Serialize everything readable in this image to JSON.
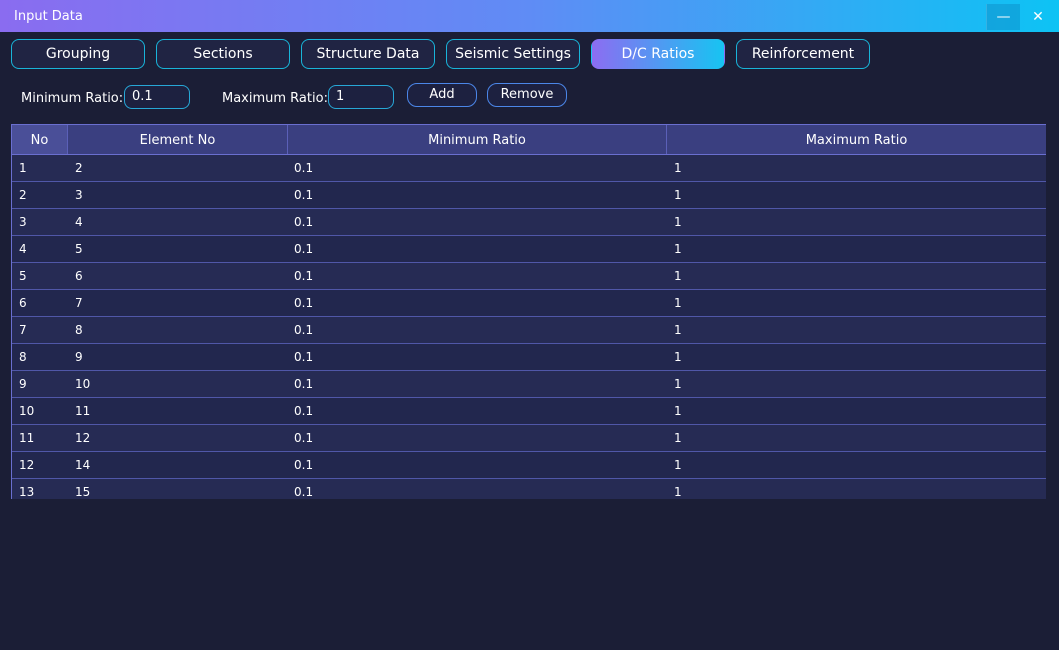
{
  "window": {
    "title": "Input Data",
    "minimize_glyph": "—",
    "close_glyph": "✕"
  },
  "tabs": [
    {
      "label": "Grouping",
      "active": false
    },
    {
      "label": "Sections",
      "active": false
    },
    {
      "label": "Structure Data",
      "active": false
    },
    {
      "label": "Seismic Settings",
      "active": false
    },
    {
      "label": "D/C Ratios",
      "active": true
    },
    {
      "label": "Reinforcement",
      "active": false
    }
  ],
  "controls": {
    "min_label": "Minimum Ratio:",
    "min_value": "0.1",
    "max_label": "Maximum Ratio:",
    "max_value": "1",
    "add_label": "Add",
    "remove_label": "Remove"
  },
  "table": {
    "columns": [
      "No",
      "Element No",
      "Minimum Ratio",
      "Maximum Ratio"
    ],
    "rows": [
      [
        "1",
        "2",
        "0.1",
        "1"
      ],
      [
        "2",
        "3",
        "0.1",
        "1"
      ],
      [
        "3",
        "4",
        "0.1",
        "1"
      ],
      [
        "4",
        "5",
        "0.1",
        "1"
      ],
      [
        "5",
        "6",
        "0.1",
        "1"
      ],
      [
        "6",
        "7",
        "0.1",
        "1"
      ],
      [
        "7",
        "8",
        "0.1",
        "1"
      ],
      [
        "8",
        "9",
        "0.1",
        "1"
      ],
      [
        "9",
        "10",
        "0.1",
        "1"
      ],
      [
        "10",
        "11",
        "0.1",
        "1"
      ],
      [
        "11",
        "12",
        "0.1",
        "1"
      ],
      [
        "12",
        "14",
        "0.1",
        "1"
      ],
      [
        "13",
        "15",
        "0.1",
        "1"
      ]
    ]
  },
  "colors": {
    "background": "#1b1e36",
    "accent_start": "#8c6df2",
    "accent_end": "#17c4f2",
    "table_header": "#3a3f80"
  }
}
